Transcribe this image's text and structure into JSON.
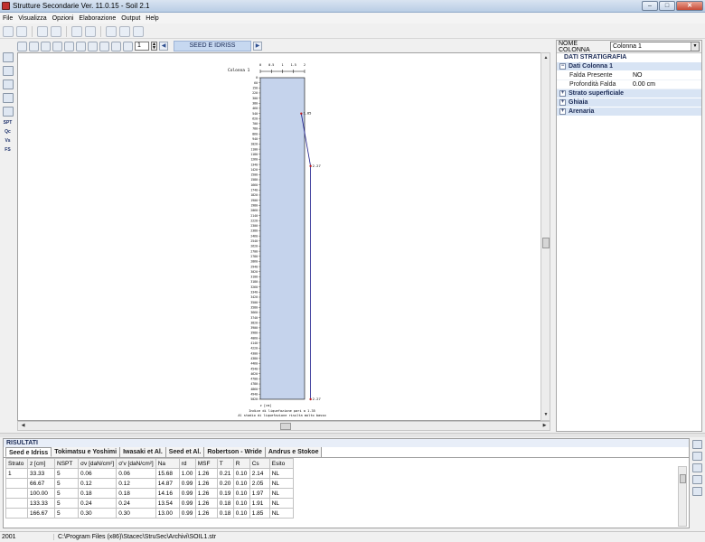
{
  "window": {
    "title": "Strutture Secondarie Ver. 11.0.15 - Soil 2.1"
  },
  "menu": [
    "File",
    "Visualizza",
    "Opzioni",
    "Elaborazione",
    "Output",
    "Help"
  ],
  "left_tools": [
    "SPT",
    "Qc",
    "Vs",
    "FS"
  ],
  "chart_toolbar": {
    "page": "1",
    "view_label": "SEED E IDRISS"
  },
  "chart_data": {
    "type": "line",
    "column_label": "Colonna 1",
    "depth_unit_label": "z [cm]",
    "x_tick_labels": [
      "0",
      "0.5",
      "1",
      "1.5",
      "2"
    ],
    "y_tick_labels": [
      "0",
      "60",
      "150",
      "220",
      "300",
      "380",
      "460",
      "540",
      "620",
      "700",
      "780",
      "860",
      "940",
      "1020",
      "1100",
      "1180",
      "1260",
      "1340",
      "1420",
      "1500",
      "1580",
      "1660",
      "1740",
      "1820",
      "1900",
      "1980",
      "2060",
      "2140",
      "2220",
      "2300",
      "2380",
      "2460",
      "2540",
      "2620",
      "2700",
      "2780",
      "2860",
      "2940",
      "3020",
      "3100",
      "3180",
      "3260",
      "3340",
      "3420",
      "3500",
      "3580",
      "3660",
      "3740",
      "3820",
      "3900",
      "3980",
      "4060",
      "4140",
      "4220",
      "4300",
      "4380",
      "4460",
      "4540",
      "4620",
      "4700",
      "4780",
      "4860",
      "4940",
      "5020"
    ],
    "ylim": [
      0,
      5020
    ],
    "xlim": [
      0,
      2
    ],
    "series": [
      {
        "values": [
          {
            "x": 1.85,
            "y": 560
          },
          {
            "x": 2.27,
            "y": 1380
          },
          {
            "x": 2.27,
            "y": 5020
          }
        ]
      }
    ],
    "point_labels": [
      "1.85",
      "2.27",
      "2.27"
    ],
    "footer": [
      "Indice di liquefazione pari a 1.35",
      "Al stadio di liquefazione risulta molto basso"
    ]
  },
  "right_panel": {
    "label": "NOME COLONNA",
    "selected": "Colonna 1",
    "section": "DATI STRATIGRAFIA",
    "categories": [
      {
        "name": "Dati Colonna 1",
        "expanded": true,
        "rows": [
          {
            "k": "Falda Presente",
            "v": "NO"
          },
          {
            "k": "Profondità Falda",
            "v": "0.00 cm"
          }
        ]
      },
      {
        "name": "Strato superficiale",
        "expanded": false,
        "rows": []
      },
      {
        "name": "Ghiaia",
        "expanded": false,
        "rows": []
      },
      {
        "name": "Arenaria",
        "expanded": false,
        "rows": []
      }
    ]
  },
  "results": {
    "title": "RISULTATI",
    "tabs": [
      "Seed e Idriss",
      "Tokimatsu e Yoshimi",
      "Iwasaki et Al.",
      "Seed et Al.",
      "Robertson - Wride",
      "Andrus e Stokoe"
    ],
    "columns": [
      "Strato",
      "z [cm]",
      "NSPT",
      "σv [daN/cm²]",
      "σ'v [daN/cm²]",
      "Na",
      "rd",
      "MSF",
      "T",
      "R",
      "Cs",
      "Esito"
    ],
    "rows": [
      [
        "1",
        "33.33",
        "5",
        "0.06",
        "0.06",
        "15.68",
        "1.00",
        "1.26",
        "0.21",
        "0.10",
        "2.14",
        "NL"
      ],
      [
        "",
        "66.67",
        "5",
        "0.12",
        "0.12",
        "14.87",
        "0.99",
        "1.26",
        "0.20",
        "0.10",
        "2.05",
        "NL"
      ],
      [
        "",
        "100.00",
        "5",
        "0.18",
        "0.18",
        "14.16",
        "0.99",
        "1.26",
        "0.19",
        "0.10",
        "1.97",
        "NL"
      ],
      [
        "",
        "133.33",
        "5",
        "0.24",
        "0.24",
        "13.54",
        "0.99",
        "1.26",
        "0.18",
        "0.10",
        "1.91",
        "NL"
      ],
      [
        "",
        "166.67",
        "5",
        "0.30",
        "0.30",
        "13.00",
        "0.99",
        "1.26",
        "0.18",
        "0.10",
        "1.85",
        "NL"
      ]
    ]
  },
  "status": {
    "left": "2001",
    "path": "C:\\Program Files (x86)\\Stacec\\StruSec\\Archivi\\SOIL1.str"
  },
  "colors": {
    "column_fill": "#c5d3ec",
    "line": "#1a1a8a",
    "point": "#c02020"
  }
}
